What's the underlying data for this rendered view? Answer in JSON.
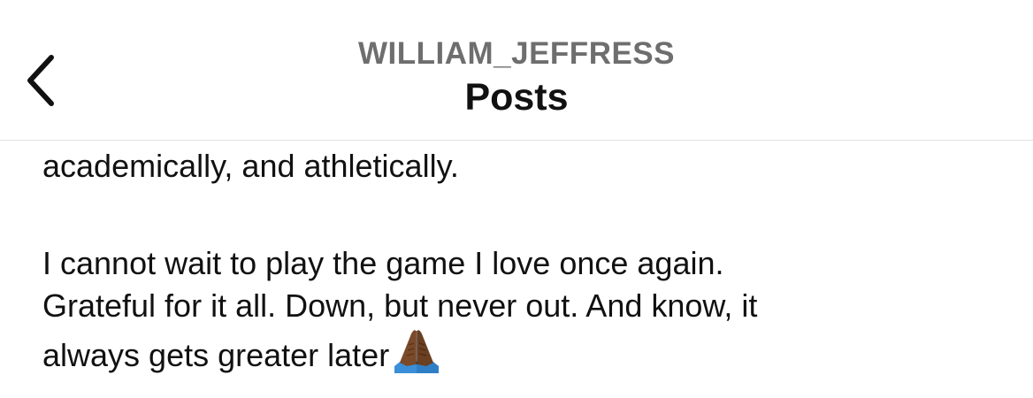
{
  "header": {
    "username": "WILLIAM_JEFFRESS",
    "title": "Posts",
    "back_icon": "chevron-left-icon"
  },
  "post": {
    "paragraph1_lines": [
      "academically, and athletically."
    ],
    "paragraph2_lines": [
      "I cannot wait to play the game I love once again.",
      "Grateful for it all. Down, but never out. And know, it",
      "always gets greater later"
    ],
    "trailing_emoji": "folded-hands-emoji"
  },
  "colors": {
    "background": "#ffffff",
    "username": "#6e6e6e",
    "title": "#111111",
    "divider": "#e3e3e3",
    "emoji_skin": "#7a4a2a",
    "emoji_sleeve": "#3a8fd8"
  }
}
